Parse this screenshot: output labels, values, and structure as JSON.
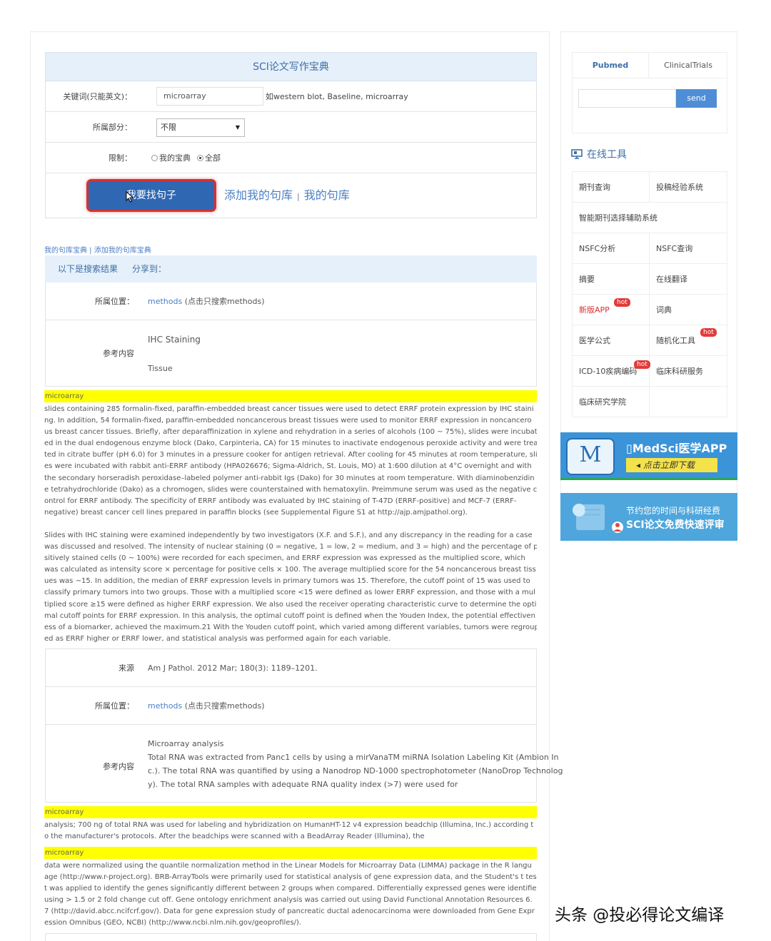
{
  "form": {
    "title": "SCI论文写作宝典",
    "keyword_label": "关键词(只能英文)：",
    "keyword_value": "microarray",
    "keyword_hint": "如western blot, Baseline, microarray",
    "section_label": "所属部分：",
    "section_value": "不限",
    "limit_label": "限制：",
    "limit_option_mine": "我的宝典",
    "limit_option_all": "全部",
    "find_button": "我要找句子",
    "add_library_link": "添加我的句库",
    "my_library_link": "我的句库"
  },
  "small_links": "我的句库宝典 | 添加我的句库宝典",
  "results": {
    "heading": "以下是搜索结果",
    "share": "分享到：",
    "location_label": "所属位置：",
    "reference_label": "参考内容",
    "source_label": "来源",
    "location_link": "methods",
    "location_note": " (点击只搜索methods)",
    "ref1": [
      "IHC Staining",
      "Tissue"
    ],
    "highlight_word": "microarray",
    "para1": [
      "slides containing 285 formalin-fixed, paraffin-embedded breast cancer tissues were used to detect ERRF protein expression by IHC staini",
      "ng. In addition, 54 formalin-fixed, paraffin-embedded noncancerous breast tissues were used to monitor ERRF expression in noncancero",
      "us breast cancer tissues. Briefly, after deparaffinization in xylene and rehydration in a series of alcohols (100 ~ 75%), slides were incubat",
      "ed in the dual endogenous enzyme block (Dako, Carpinteria, CA) for 15 minutes to inactivate endogenous peroxide activity and were trea",
      "ted in citrate buffer (pH 6.0) for 3 minutes in a pressure cooker for antigen retrieval. After cooling for 45 minutes at room temperature, slid",
      "es were incubated with rabbit anti-ERRF antibody (HPA026676; Sigma-Aldrich, St. Louis, MO) at 1:600 dilution at 4°C overnight and with",
      "the secondary horseradish peroxidase–labeled polymer anti-rabbit Igs (Dako) for 30 minutes at room temperature. With diaminobenzidin",
      "e tetrahydrochloride (Dako) as a chromogen, slides were counterstained with hematoxylin. Preimmune serum was used as the negative c",
      "ontrol for ERRF antibody. The specificity of ERRF antibody was evaluated by IHC staining of T-47D (ERRF-positive) and MCF-7 (ERRF-",
      "negative) breast cancer cell lines prepared in paraffin blocks (see Supplemental Figure S1 at http://ajp.amjpathol.org)."
    ],
    "para2": [
      "Slides with IHC staining were examined independently by two investigators (X.F. and S.F.), and any discrepancy in the reading for a case",
      "was discussed and resolved. The intensity of nuclear staining (0 = negative, 1 = low, 2 = medium, and 3 = high) and the percentage of po",
      "sitively stained cells (0 ~ 100%) were recorded for each specimen, and ERRF expression was expressed as the multiplied score, which",
      "was calculated as intensity score × percentage for positive cells × 100. The average multiplied score for the 54 noncancerous breast tiss",
      "ues was ~15. In addition, the median of ERRF expression levels in primary tumors was 15. Therefore, the cutoff point of 15 was used to",
      "classify primary tumors into two groups. Those with a multiplied score <15 were defined as lower ERRF expression, and those with a mul",
      "tiplied score ≥15 were defined as higher ERRF expression. We also used the receiver operating characteristic curve to determine the opti",
      "mal cutoff points for ERRF expression. In this analysis, the optimal cutoff point is defined when the Youden Index, the potential effectiven",
      "ess of a biomarker, achieved the maximum.21 With the Youden cutoff point, which varied among different variables, tumors were regroup",
      "ed as ERRF higher or ERRF lower, and statistical analysis was performed again for each variable."
    ],
    "source_value": "Am J Pathol. 2012 Mar; 180(3): 1189–1201.",
    "ref2": [
      "Microarray analysis",
      "Total RNA was extracted from Panc1 cells by using a mirVanaTM miRNA Isolation Labeling Kit (Ambion In",
      "c.). The total RNA was quantified by using a Nanodrop ND-1000 spectrophotometer (NanoDrop Technolog",
      "y). The total RNA samples with adequate RNA quality index (>7) were used for"
    ],
    "para3": [
      "analysis; 700 ng of total RNA was used for labeling and hybridization on HumanHT-12 v4 expression beadchip (Illumina, Inc.) according t",
      "o the manufacturer's protocols. After the beadchips were scanned with a BeadArray Reader (Illumina), the"
    ],
    "para4": [
      "data were normalized using the quantile normalization method in the Linear Models for Microarray Data (LIMMA) package in the R langu",
      "age (http://www.r-project.org). BRB-ArrayTools were primarily used for statistical analysis of gene expression data, and the Student's t tes",
      "t was applied to identify the genes significantly different between 2 groups when compared. Differentially expressed genes were identified",
      "using > 1.5 or 2 fold change cut off. Gene ontology enrichment analysis was carried out using David Functional Annotation Resources 6.",
      "7 (http://david.abcc.ncifcrf.gov/). Data for gene expression study of pancreatic ductal adenocarcinoma were downloaded from Gene Expr",
      "ession Omnibus (GEO, NCBI) (http://www.ncbi.nlm.nih.gov/geoprofiles/)."
    ]
  },
  "sidebar": {
    "tab_pubmed": "Pubmed",
    "tab_clinical": "ClinicalTrials",
    "send_button": "send",
    "tools_title": "在线工具",
    "hot_badge": "hot",
    "tools": {
      "journal_query": "期刊查询",
      "submission_system": "投稿经验系统",
      "smart_journal": "智能期刊选择辅助系统",
      "nsfc_analysis": "NSFC分析",
      "nsfc_query": "NSFC查询",
      "abstract": "摘要",
      "online_translate": "在线翻译",
      "new_app": "新版APP",
      "dictionary": "词典",
      "medical_formula": "医学公式",
      "randomization": "随机化工具",
      "icd10": "ICD-10疾病编码",
      "clinical_service": "临床科研服务",
      "clinical_academy": "临床研究学院"
    },
    "app_banner_title": "MedSci医学APP",
    "app_banner_download": "点击立即下载",
    "app_banner_logo": "M",
    "sci_banner_line1": "节约您的时间与科研经费",
    "sci_banner_line2": "SCI论文免费快速评审"
  },
  "watermark": "头条 @投必得论文编译",
  "colors": {
    "accent": "#3e6fa6",
    "highlight": "#ffff00",
    "button": "#2f67b3",
    "hot": "#e23b3b"
  }
}
